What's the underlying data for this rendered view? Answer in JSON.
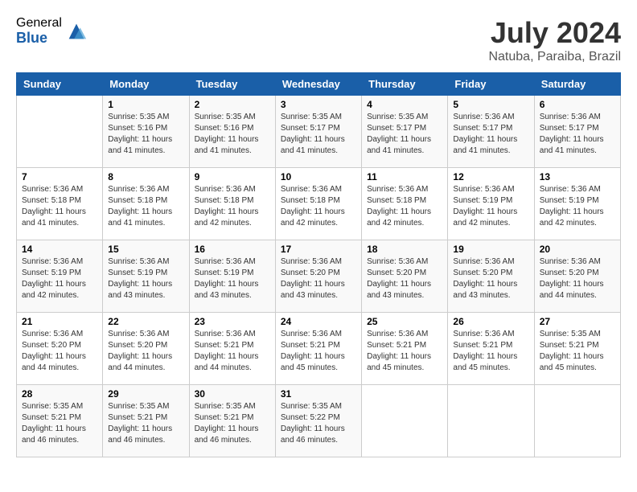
{
  "header": {
    "logo_general": "General",
    "logo_blue": "Blue",
    "month_year": "July 2024",
    "location": "Natuba, Paraiba, Brazil"
  },
  "calendar": {
    "days_of_week": [
      "Sunday",
      "Monday",
      "Tuesday",
      "Wednesday",
      "Thursday",
      "Friday",
      "Saturday"
    ],
    "weeks": [
      [
        {
          "day": "",
          "info": ""
        },
        {
          "day": "1",
          "info": "Sunrise: 5:35 AM\nSunset: 5:16 PM\nDaylight: 11 hours\nand 41 minutes."
        },
        {
          "day": "2",
          "info": "Sunrise: 5:35 AM\nSunset: 5:16 PM\nDaylight: 11 hours\nand 41 minutes."
        },
        {
          "day": "3",
          "info": "Sunrise: 5:35 AM\nSunset: 5:17 PM\nDaylight: 11 hours\nand 41 minutes."
        },
        {
          "day": "4",
          "info": "Sunrise: 5:35 AM\nSunset: 5:17 PM\nDaylight: 11 hours\nand 41 minutes."
        },
        {
          "day": "5",
          "info": "Sunrise: 5:36 AM\nSunset: 5:17 PM\nDaylight: 11 hours\nand 41 minutes."
        },
        {
          "day": "6",
          "info": "Sunrise: 5:36 AM\nSunset: 5:17 PM\nDaylight: 11 hours\nand 41 minutes."
        }
      ],
      [
        {
          "day": "7",
          "info": "Sunrise: 5:36 AM\nSunset: 5:18 PM\nDaylight: 11 hours\nand 41 minutes."
        },
        {
          "day": "8",
          "info": "Sunrise: 5:36 AM\nSunset: 5:18 PM\nDaylight: 11 hours\nand 41 minutes."
        },
        {
          "day": "9",
          "info": "Sunrise: 5:36 AM\nSunset: 5:18 PM\nDaylight: 11 hours\nand 42 minutes."
        },
        {
          "day": "10",
          "info": "Sunrise: 5:36 AM\nSunset: 5:18 PM\nDaylight: 11 hours\nand 42 minutes."
        },
        {
          "day": "11",
          "info": "Sunrise: 5:36 AM\nSunset: 5:18 PM\nDaylight: 11 hours\nand 42 minutes."
        },
        {
          "day": "12",
          "info": "Sunrise: 5:36 AM\nSunset: 5:19 PM\nDaylight: 11 hours\nand 42 minutes."
        },
        {
          "day": "13",
          "info": "Sunrise: 5:36 AM\nSunset: 5:19 PM\nDaylight: 11 hours\nand 42 minutes."
        }
      ],
      [
        {
          "day": "14",
          "info": "Sunrise: 5:36 AM\nSunset: 5:19 PM\nDaylight: 11 hours\nand 42 minutes."
        },
        {
          "day": "15",
          "info": "Sunrise: 5:36 AM\nSunset: 5:19 PM\nDaylight: 11 hours\nand 43 minutes."
        },
        {
          "day": "16",
          "info": "Sunrise: 5:36 AM\nSunset: 5:19 PM\nDaylight: 11 hours\nand 43 minutes."
        },
        {
          "day": "17",
          "info": "Sunrise: 5:36 AM\nSunset: 5:20 PM\nDaylight: 11 hours\nand 43 minutes."
        },
        {
          "day": "18",
          "info": "Sunrise: 5:36 AM\nSunset: 5:20 PM\nDaylight: 11 hours\nand 43 minutes."
        },
        {
          "day": "19",
          "info": "Sunrise: 5:36 AM\nSunset: 5:20 PM\nDaylight: 11 hours\nand 43 minutes."
        },
        {
          "day": "20",
          "info": "Sunrise: 5:36 AM\nSunset: 5:20 PM\nDaylight: 11 hours\nand 44 minutes."
        }
      ],
      [
        {
          "day": "21",
          "info": "Sunrise: 5:36 AM\nSunset: 5:20 PM\nDaylight: 11 hours\nand 44 minutes."
        },
        {
          "day": "22",
          "info": "Sunrise: 5:36 AM\nSunset: 5:20 PM\nDaylight: 11 hours\nand 44 minutes."
        },
        {
          "day": "23",
          "info": "Sunrise: 5:36 AM\nSunset: 5:21 PM\nDaylight: 11 hours\nand 44 minutes."
        },
        {
          "day": "24",
          "info": "Sunrise: 5:36 AM\nSunset: 5:21 PM\nDaylight: 11 hours\nand 45 minutes."
        },
        {
          "day": "25",
          "info": "Sunrise: 5:36 AM\nSunset: 5:21 PM\nDaylight: 11 hours\nand 45 minutes."
        },
        {
          "day": "26",
          "info": "Sunrise: 5:36 AM\nSunset: 5:21 PM\nDaylight: 11 hours\nand 45 minutes."
        },
        {
          "day": "27",
          "info": "Sunrise: 5:35 AM\nSunset: 5:21 PM\nDaylight: 11 hours\nand 45 minutes."
        }
      ],
      [
        {
          "day": "28",
          "info": "Sunrise: 5:35 AM\nSunset: 5:21 PM\nDaylight: 11 hours\nand 46 minutes."
        },
        {
          "day": "29",
          "info": "Sunrise: 5:35 AM\nSunset: 5:21 PM\nDaylight: 11 hours\nand 46 minutes."
        },
        {
          "day": "30",
          "info": "Sunrise: 5:35 AM\nSunset: 5:21 PM\nDaylight: 11 hours\nand 46 minutes."
        },
        {
          "day": "31",
          "info": "Sunrise: 5:35 AM\nSunset: 5:22 PM\nDaylight: 11 hours\nand 46 minutes."
        },
        {
          "day": "",
          "info": ""
        },
        {
          "day": "",
          "info": ""
        },
        {
          "day": "",
          "info": ""
        }
      ]
    ]
  }
}
